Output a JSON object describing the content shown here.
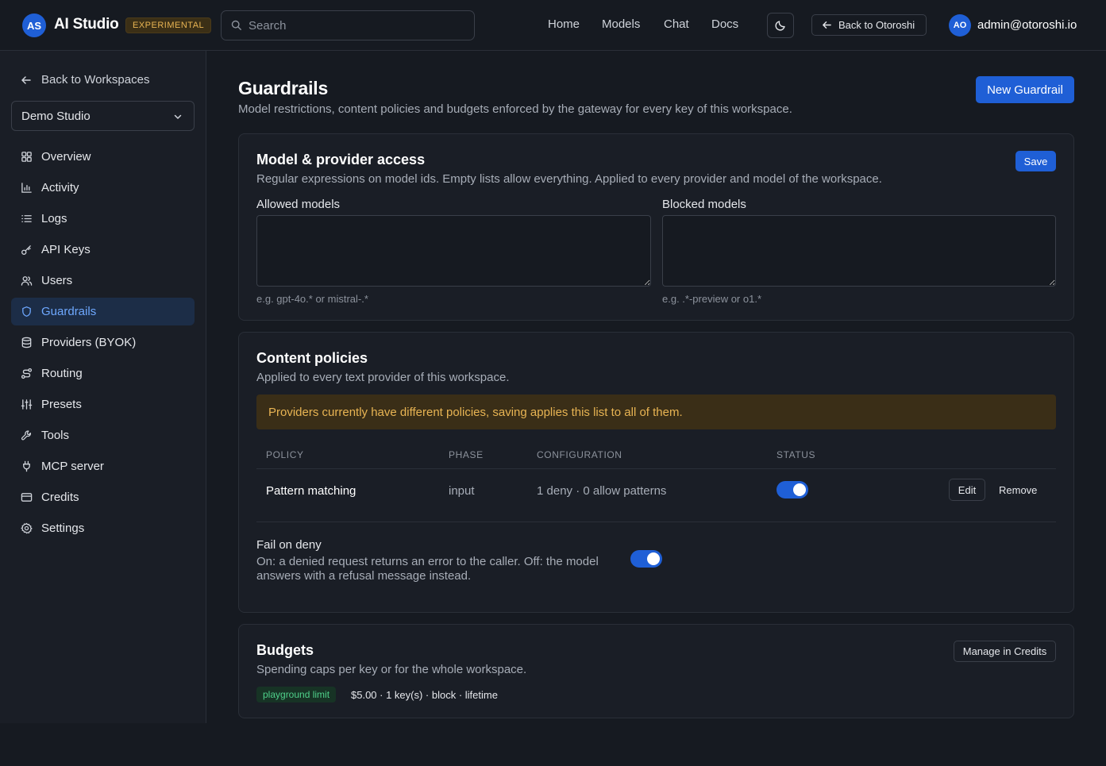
{
  "header": {
    "logo_initials": "AS",
    "app_name": "AI Studio",
    "badge": "EXPERIMENTAL",
    "search_placeholder": "Search",
    "nav": [
      "Home",
      "Models",
      "Chat",
      "Docs"
    ],
    "back_label": "Back to Otoroshi",
    "avatar_initials": "AO",
    "user_email": "admin@otoroshi.io"
  },
  "sidebar": {
    "back_label": "Back to Workspaces",
    "workspace": "Demo Studio",
    "items": [
      {
        "label": "Overview",
        "icon": "grid-icon"
      },
      {
        "label": "Activity",
        "icon": "bar-chart-icon"
      },
      {
        "label": "Logs",
        "icon": "list-icon"
      },
      {
        "label": "API Keys",
        "icon": "key-icon"
      },
      {
        "label": "Users",
        "icon": "users-icon"
      },
      {
        "label": "Guardrails",
        "icon": "shield-icon",
        "active": true
      },
      {
        "label": "Providers (BYOK)",
        "icon": "database-icon"
      },
      {
        "label": "Routing",
        "icon": "route-icon"
      },
      {
        "label": "Presets",
        "icon": "sliders-icon"
      },
      {
        "label": "Tools",
        "icon": "wrench-icon"
      },
      {
        "label": "MCP server",
        "icon": "plug-icon"
      },
      {
        "label": "Credits",
        "icon": "credit-card-icon"
      },
      {
        "label": "Settings",
        "icon": "gear-icon"
      }
    ]
  },
  "page": {
    "title": "Guardrails",
    "subtitle": "Model restrictions, content policies and budgets enforced by the gateway for every key of this workspace.",
    "new_button": "New Guardrail"
  },
  "model_access": {
    "title": "Model & provider access",
    "subtitle": "Regular expressions on model ids. Empty lists allow everything. Applied to every provider and model of the workspace.",
    "save_label": "Save",
    "allowed_label": "Allowed models",
    "allowed_value": "",
    "allowed_hint": "e.g. gpt-4o.* or mistral-.*",
    "blocked_label": "Blocked models",
    "blocked_value": "",
    "blocked_hint": "e.g. .*-preview or o1.*"
  },
  "content_policies": {
    "title": "Content policies",
    "subtitle": "Applied to every text provider of this workspace.",
    "warning": "Providers currently have different policies, saving applies this list to all of them.",
    "columns": [
      "POLICY",
      "PHASE",
      "CONFIGURATION",
      "STATUS"
    ],
    "rows": [
      {
        "policy": "Pattern matching",
        "phase": "input",
        "configuration": "1 deny · 0 allow patterns",
        "enabled": true,
        "edit": "Edit",
        "remove": "Remove"
      }
    ],
    "fail_on_deny": {
      "label": "Fail on deny",
      "description": "On: a denied request returns an error to the caller. Off: the model answers with a refusal message instead.",
      "enabled": true
    }
  },
  "budgets": {
    "title": "Budgets",
    "subtitle": "Spending caps per key or for the whole workspace.",
    "manage_label": "Manage in Credits",
    "tag": "playground limit",
    "detail": "$5.00 · 1 key(s) · block · lifetime"
  },
  "colors": {
    "accent": "#1f5fd6",
    "warning_text": "#e8b453",
    "tag_text": "#4fd08a"
  }
}
